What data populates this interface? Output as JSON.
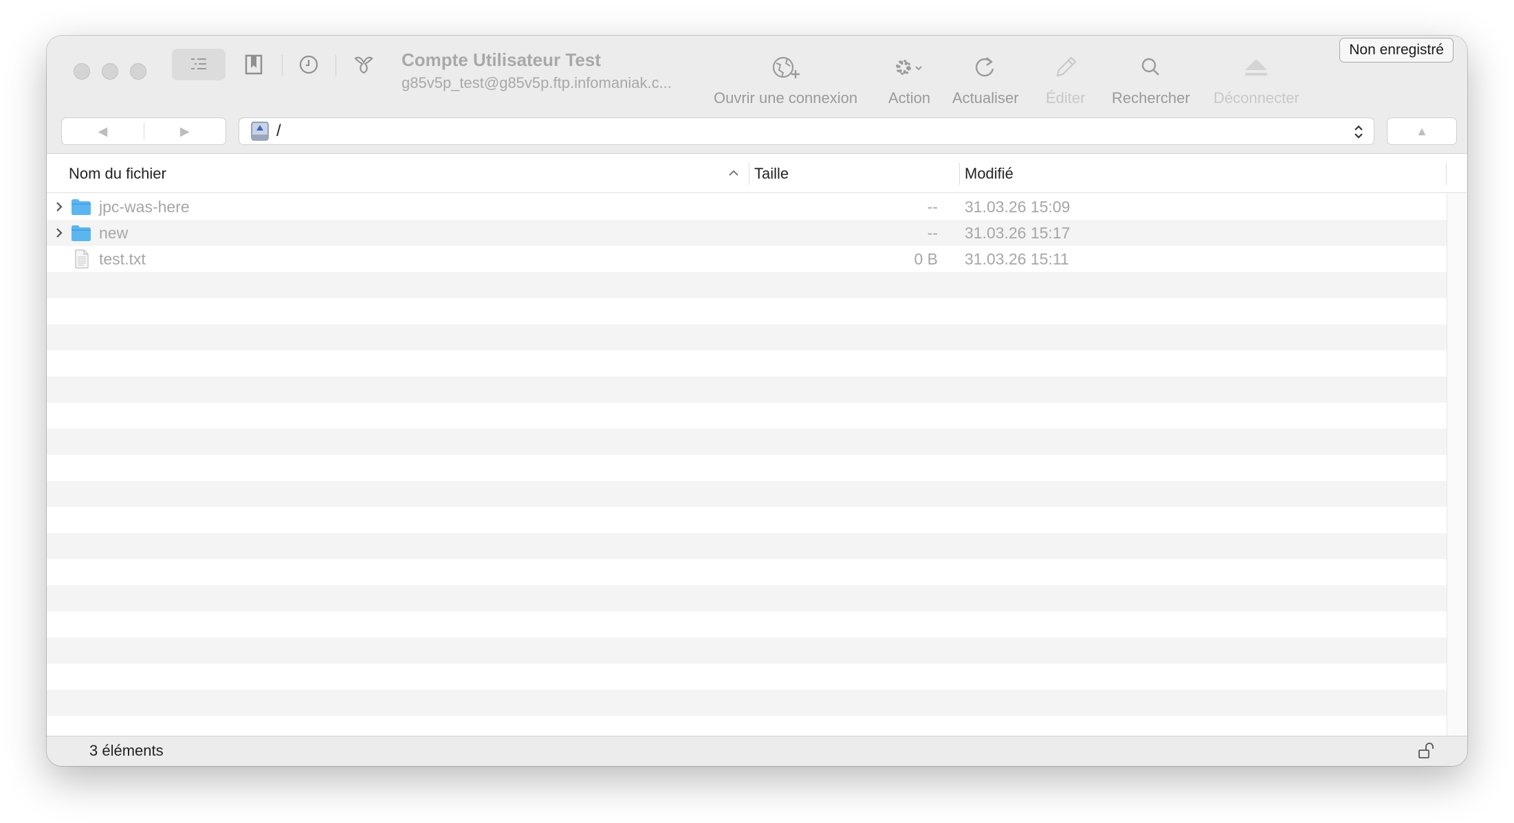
{
  "window": {
    "connection_title": "Compte Utilisateur Test",
    "connection_subtitle": "g85v5p_test@g85v5p.ftp.infomaniak.c...",
    "unregistered_label": "Non enregistré"
  },
  "toolbar": {
    "items": [
      {
        "label": "Ouvrir une connexion",
        "icon": "globe-plus-icon",
        "enabled": true
      },
      {
        "label": "Action",
        "icon": "gear-dropdown-icon",
        "enabled": true
      },
      {
        "label": "Actualiser",
        "icon": "refresh-icon",
        "enabled": true
      },
      {
        "label": "Éditer",
        "icon": "pencil-icon",
        "enabled": false
      },
      {
        "label": "Rechercher",
        "icon": "search-icon",
        "enabled": true
      },
      {
        "label": "Déconnecter",
        "icon": "eject-icon",
        "enabled": false
      }
    ]
  },
  "pathbar": {
    "path": "/"
  },
  "columns": {
    "name": "Nom du fichier",
    "size": "Taille",
    "modified": "Modifié"
  },
  "files": [
    {
      "name": "jpc-was-here",
      "type": "folder",
      "size": "--",
      "modified": "31.03.26 15:09"
    },
    {
      "name": "new",
      "type": "folder",
      "size": "--",
      "modified": "31.03.26 15:17"
    },
    {
      "name": "test.txt",
      "type": "file",
      "size": "0 B",
      "modified": "31.03.26 15:11"
    }
  ],
  "status": {
    "count": "3 éléments"
  },
  "colors": {
    "folder": "#5bb6ef",
    "titlebar": "#ececec",
    "stripe": "#f4f4f4"
  }
}
